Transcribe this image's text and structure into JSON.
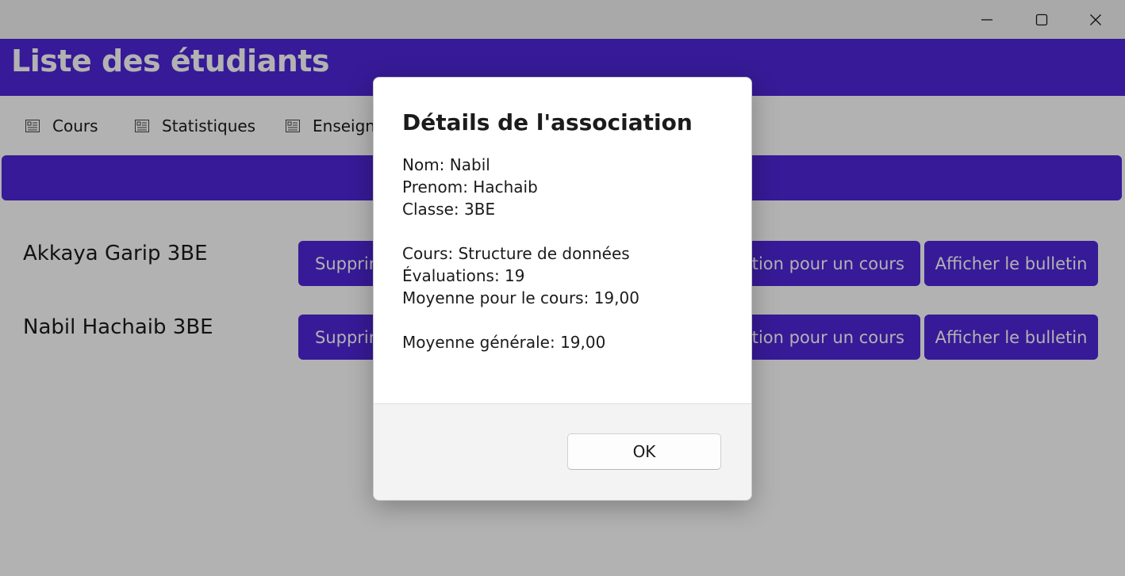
{
  "window": {
    "minimize_icon": "minimize-icon",
    "maximize_icon": "maximize-icon",
    "close_icon": "close-icon"
  },
  "header": {
    "title": "Liste des étudiants"
  },
  "nav": {
    "items": [
      {
        "label": "Cours",
        "icon": "list-icon"
      },
      {
        "label": "Statistiques",
        "icon": "list-icon"
      },
      {
        "label": "Enseignants",
        "icon": "list-icon"
      }
    ]
  },
  "students": [
    {
      "name": "Akkaya Garip 3BE",
      "delete_label": "Supprimer",
      "eval_label": "Ajouter une évaluation pour un cours",
      "bulletin_label": "Afficher le bulletin"
    },
    {
      "name": "Nabil Hachaib 3BE",
      "delete_label": "Supprimer",
      "eval_label": "Ajouter une évaluation pour un cours",
      "bulletin_label": "Afficher le bulletin"
    }
  ],
  "dialog": {
    "title": "Détails de l'association",
    "nom": "Nom: Nabil",
    "prenom": "Prenom: Hachaib",
    "classe": "Classe: 3BE",
    "cours": "Cours: Structure de données",
    "evaluations": "Évaluations: 19",
    "moyenne_cours": "Moyenne pour le cours: 19,00",
    "moyenne_generale": "Moyenne générale: 19,00",
    "ok_label": "OK"
  },
  "colors": {
    "accent": "#5026d9",
    "header_text": "#ffffff",
    "overlay": "rgba(0,0,0,0.30)"
  }
}
